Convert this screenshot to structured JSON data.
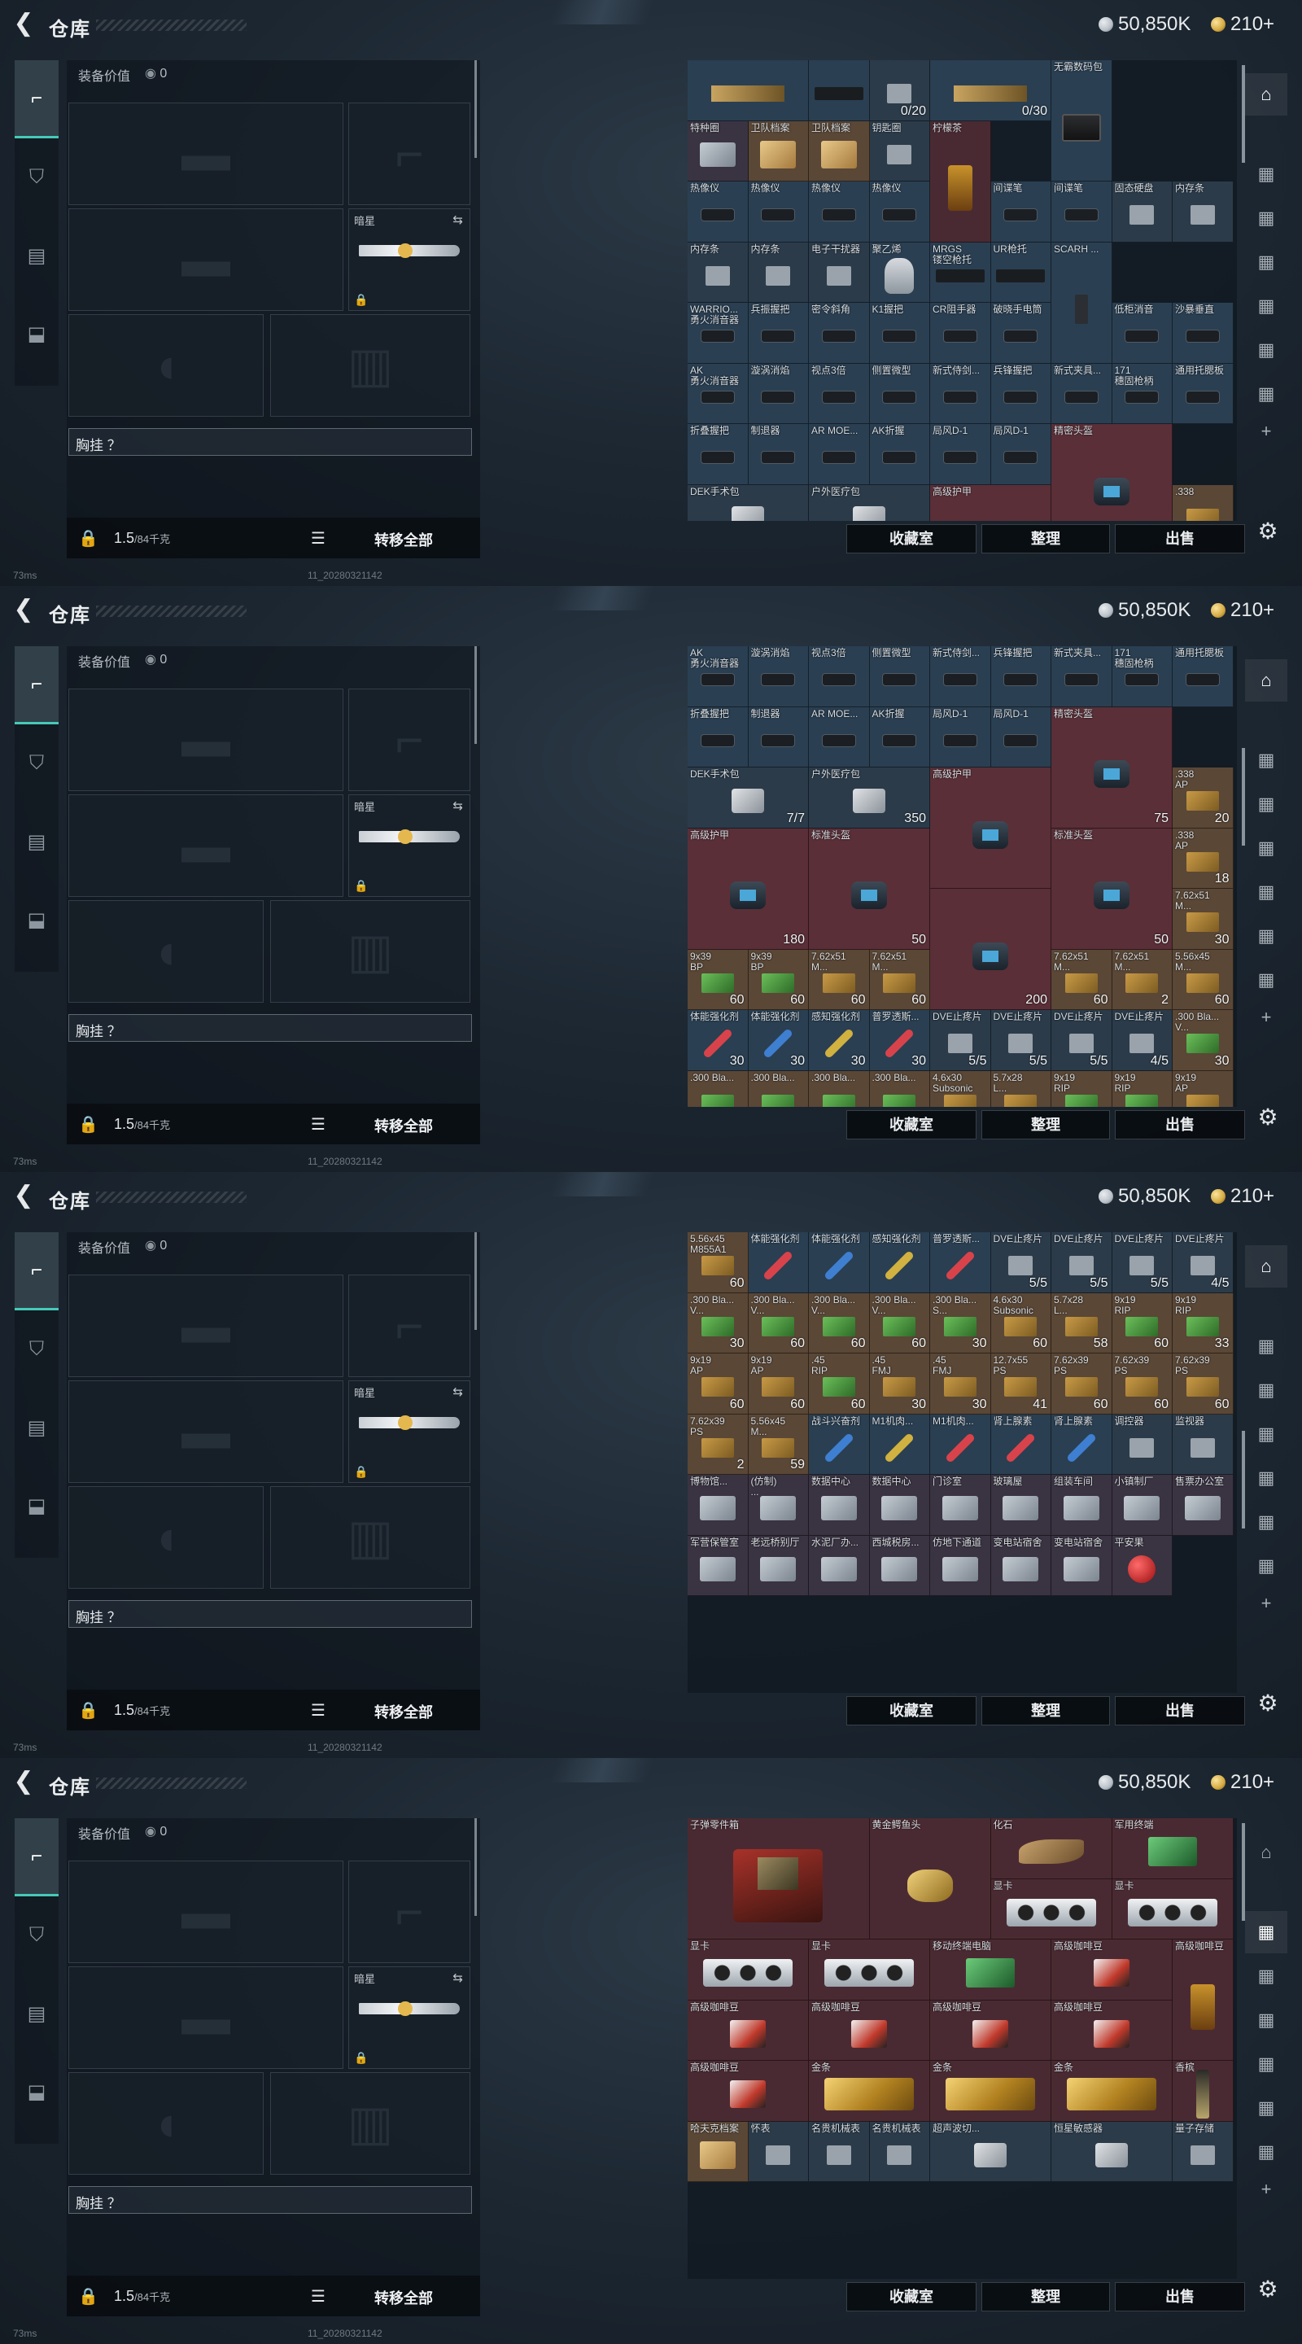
{
  "common": {
    "title": "仓库",
    "currency1": "50,850K",
    "currency2": "210+",
    "currency1_color": "#b9c0c7",
    "currency2_color": "#d4a942",
    "equip_label": "装备价值",
    "equip_value": "0",
    "melee_name": "暗星",
    "vest_label": "胸挂 ？",
    "weight": "1.5",
    "weight_cap": "/84千克",
    "transfer_all": "转移全部",
    "buttons": [
      "收藏室",
      "整理",
      "出售"
    ],
    "ping": "73ms",
    "version": "11_20280321142",
    "accent": "#46c9b8"
  },
  "panels": [
    {
      "scroll_pos": 0.0,
      "rightnav_active": 0
    },
    {
      "scroll_pos": 0.33,
      "rightnav_active": 0
    },
    {
      "scroll_pos": 0.66,
      "rightnav_active": 0
    },
    {
      "scroll_pos": 0.0,
      "rightnav_active": 1
    }
  ],
  "grids": [
    {
      "rows": [
        [
          [
            "",
            "rifle",
            ""
          ],
          [
            "",
            "gun",
            ""
          ],
          [
            "",
            "chip",
            "0/20"
          ],
          [
            "",
            "rifle",
            "0/30"
          ],
          [
            "无霸数码包",
            "radio",
            ""
          ]
        ],
        [
          [
            "特种圈",
            "card",
            ""
          ],
          [
            "卫队档案",
            "doc",
            ""
          ],
          [
            "卫队档案",
            "doc",
            ""
          ],
          [
            "钥匙圈",
            "chip",
            ""
          ],
          [
            "柠檬茶",
            "bag",
            ""
          ]
        ],
        [
          [
            "热像仪",
            "part",
            ""
          ],
          [
            "热像仪",
            "part",
            ""
          ],
          [
            "热像仪",
            "part",
            ""
          ],
          [
            "热像仪",
            "part",
            ""
          ],
          [
            "间谍笔",
            "part",
            ""
          ],
          [
            "间谍笔",
            "part",
            ""
          ],
          [
            "固态硬盘",
            "chip",
            ""
          ],
          [
            "内存条",
            "chip",
            ""
          ]
        ],
        [
          [
            "内存条",
            "chip",
            ""
          ],
          [
            "内存条",
            "chip",
            ""
          ],
          [
            "电子干扰器",
            "chip",
            ""
          ],
          [
            "聚乙烯",
            "kettle",
            ""
          ],
          [
            "MRGS\n镂空枪托",
            "gun",
            ""
          ],
          [
            "UR枪托",
            "gun",
            ""
          ],
          [
            "SCARH ...",
            "mag",
            ""
          ]
        ],
        [
          [
            "WARRIO...\n勇火消音器",
            "part",
            ""
          ],
          [
            "兵振握把",
            "part",
            ""
          ],
          [
            "密令斜角",
            "part",
            ""
          ],
          [
            "K1握把",
            "part",
            ""
          ],
          [
            "CR阻手器",
            "part",
            ""
          ],
          [
            "破晓手电筒",
            "part",
            ""
          ],
          [
            "低柜消音",
            "part",
            ""
          ],
          [
            "沙暴垂直",
            "part",
            ""
          ]
        ],
        [
          [
            "AK\n勇火消音器",
            "part",
            ""
          ],
          [
            "漩涡消焰",
            "part",
            ""
          ],
          [
            "视点3倍",
            "part",
            ""
          ],
          [
            "侧置微型",
            "part",
            ""
          ],
          [
            "新式侍剑...",
            "part",
            ""
          ],
          [
            "兵锋握把",
            "part",
            ""
          ],
          [
            "新式夹具...",
            "part",
            ""
          ],
          [
            "171\n穗固枪柄",
            "part",
            ""
          ],
          [
            "通用托腮板",
            "part",
            ""
          ]
        ],
        [
          [
            "折叠握把",
            "part",
            ""
          ],
          [
            "制退器",
            "part",
            ""
          ],
          [
            "AR MOE...",
            "part",
            ""
          ],
          [
            "AK折握",
            "part",
            ""
          ],
          [
            "局风D-1",
            "part",
            ""
          ],
          [
            "局风D-1",
            "part",
            ""
          ],
          [
            "精密头盔",
            "gear",
            "75"
          ]
        ],
        [
          [
            "DEK手术包",
            "tool",
            ""
          ],
          [
            "户外医疗包",
            "tool",
            ""
          ],
          [
            "高级护甲",
            "gear",
            ""
          ],
          [
            ".338",
            "ammo",
            ""
          ]
        ]
      ]
    },
    {
      "rows": [
        [
          [
            "AK\n勇火消音器",
            "part",
            ""
          ],
          [
            "漩涡消焰",
            "part",
            ""
          ],
          [
            "视点3倍",
            "part",
            ""
          ],
          [
            "侧置微型",
            "part",
            ""
          ],
          [
            "新式侍剑...",
            "part",
            ""
          ],
          [
            "兵锋握把",
            "part",
            ""
          ],
          [
            "新式夹具...",
            "part",
            ""
          ],
          [
            "171\n穗固枪柄",
            "part",
            ""
          ],
          [
            "通用托腮板",
            "part",
            ""
          ]
        ],
        [
          [
            "折叠握把",
            "part",
            ""
          ],
          [
            "制退器",
            "part",
            ""
          ],
          [
            "AR MOE...",
            "part",
            ""
          ],
          [
            "AK折握",
            "part",
            ""
          ],
          [
            "局风D-1",
            "part",
            ""
          ],
          [
            "局风D-1",
            "part",
            ""
          ],
          [
            "精密头盔",
            "gear",
            "75"
          ]
        ],
        [
          [
            "DEK手术包",
            "tool",
            "7/7"
          ],
          [
            "户外医疗包",
            "tool",
            "350"
          ],
          [
            "高级护甲",
            "gear",
            ""
          ],
          [
            ".338\nAP",
            "ammo",
            "20"
          ]
        ],
        [
          [
            "高级护甲",
            "gear",
            "180"
          ],
          [
            "标准头盔",
            "gear",
            "50"
          ],
          [
            "标准头盔",
            "gear",
            "50"
          ],
          [
            "",
            "gear",
            "200"
          ],
          [
            ".338\nAP",
            "ammo",
            "18"
          ]
        ],
        [
          [
            "7.62x51\nM...",
            "ammo",
            "30"
          ],
          [
            "9x39\nBP",
            "ammog",
            "60"
          ],
          [
            "9x39\nBP",
            "ammog",
            "60"
          ],
          [
            "7.62x51\nM...",
            "ammo",
            "60"
          ],
          [
            "7.62x51\nM...",
            "ammo",
            "60"
          ],
          [
            "7.62x51\nM...",
            "ammo",
            "60"
          ],
          [
            "7.62x51\nM...",
            "ammo",
            "2"
          ]
        ],
        [
          [
            "5.56x45\nM...",
            "ammo",
            "60"
          ],
          [
            "体能强化剂",
            "inj",
            "30"
          ],
          [
            "体能强化剂",
            "inj",
            "30"
          ],
          [
            "感知强化剂",
            "inj",
            "30"
          ],
          [
            "普罗透斯...",
            "inj",
            "30"
          ],
          [
            "DVE止疼片",
            "chip",
            "5/5"
          ],
          [
            "DVE止疼片",
            "chip",
            "5/5"
          ],
          [
            "DVE止疼片",
            "chip",
            "5/5"
          ],
          [
            "DVE止疼片",
            "chip",
            "4/5"
          ]
        ],
        [
          [
            ".300 Bla...\nV...",
            "ammog",
            "30"
          ],
          [
            ".300 Bla...",
            "ammog",
            "60"
          ],
          [
            ".300 Bla...",
            "ammog",
            "60"
          ],
          [
            ".300 Bla...",
            "ammog",
            "60"
          ],
          [
            ".300 Bla...",
            "ammog",
            "30"
          ],
          [
            "4.6x30\nSubsonic",
            "ammo",
            "60"
          ],
          [
            "5.7x28\nL...",
            "ammo",
            "58"
          ],
          [
            "9x19\nRIP",
            "ammog",
            "60"
          ],
          [
            "9x19\nRIP",
            "ammog",
            "33"
          ]
        ],
        [
          [
            "9x19\nAP",
            "ammo",
            ""
          ],
          [
            "9x19\nAP",
            "ammo",
            ""
          ],
          [
            ".45",
            "ammo",
            ""
          ],
          [
            ".45",
            "ammo",
            ""
          ],
          [
            "12.7x55\nPS",
            "ammo",
            ""
          ],
          [
            "7.62x39\nPS",
            "ammo",
            ""
          ],
          [
            "7.62x39\nPS",
            "ammo",
            ""
          ],
          [
            "7.62x39\nPS",
            "ammo",
            ""
          ]
        ]
      ]
    },
    {
      "rows": [
        [
          [
            "5.56x45\nM855A1",
            "ammo",
            "60"
          ],
          [
            "体能强化剂",
            "inj",
            ""
          ],
          [
            "体能强化剂",
            "inj",
            ""
          ],
          [
            "感知强化剂",
            "inj",
            ""
          ],
          [
            "普罗透斯...",
            "inj",
            ""
          ],
          [
            "DVE止疼片",
            "chip",
            "5/5"
          ],
          [
            "DVE止疼片",
            "chip",
            "5/5"
          ],
          [
            "DVE止疼片",
            "chip",
            "5/5"
          ],
          [
            "DVE止疼片",
            "chip",
            "4/5"
          ]
        ],
        [
          [
            ".300 Bla...\nV...",
            "ammog",
            "30"
          ],
          [
            ".300 Bla...\nV...",
            "ammog",
            "60"
          ],
          [
            ".300 Bla...\nV...",
            "ammog",
            "60"
          ],
          [
            ".300 Bla...\nV...",
            "ammog",
            "60"
          ],
          [
            ".300 Bla...\nS...",
            "ammog",
            "30"
          ],
          [
            "4.6x30\nSubsonic",
            "ammo",
            "60"
          ],
          [
            "5.7x28\nL...",
            "ammo",
            "58"
          ],
          [
            "9x19\nRIP",
            "ammog",
            "60"
          ],
          [
            "9x19\nRIP",
            "ammog",
            "33"
          ]
        ],
        [
          [
            "9x19\nAP",
            "ammo",
            "60"
          ],
          [
            "9x19\nAP",
            "ammo",
            "60"
          ],
          [
            ".45\nRIP",
            "ammog",
            "60"
          ],
          [
            ".45\nFMJ",
            "ammo",
            "30"
          ],
          [
            ".45\nFMJ",
            "ammo",
            "30"
          ],
          [
            "12.7x55\nPS",
            "ammo",
            "41"
          ],
          [
            "7.62x39\nPS",
            "ammo",
            "60"
          ],
          [
            "7.62x39\nPS",
            "ammo",
            "60"
          ],
          [
            "7.62x39\nPS",
            "ammo",
            "60"
          ]
        ],
        [
          [
            "7.62x39\nPS",
            "ammo",
            "2"
          ],
          [
            "5.56x45\nM...",
            "ammo",
            "59"
          ],
          [
            "战斗兴奋剂",
            "inj",
            ""
          ],
          [
            "M1机肉...",
            "inj",
            ""
          ],
          [
            "M1机肉...",
            "inj",
            ""
          ],
          [
            "肾上腺素",
            "inj",
            ""
          ],
          [
            "肾上腺素",
            "inj",
            ""
          ],
          [
            "调控器",
            "chip",
            ""
          ],
          [
            "监视器",
            "chip",
            ""
          ]
        ],
        [
          [
            "博物馆...",
            "card",
            ""
          ],
          [
            "(仿制)\n...",
            "card",
            ""
          ],
          [
            "数据中心",
            "card",
            ""
          ],
          [
            "数据中心",
            "card",
            ""
          ],
          [
            "门诊室",
            "card",
            ""
          ],
          [
            "玻璃屋",
            "card",
            ""
          ],
          [
            "组装车间",
            "card",
            ""
          ],
          [
            "小镇制厂",
            "card",
            ""
          ],
          [
            "售票办公室",
            "card",
            ""
          ]
        ],
        [
          [
            "军营保管室",
            "card",
            ""
          ],
          [
            "老远桥别厅",
            "card",
            ""
          ],
          [
            "水泥厂办...",
            "card",
            ""
          ],
          [
            "西城税房...",
            "card",
            ""
          ],
          [
            "仿地下通道",
            "card",
            ""
          ],
          [
            "变电站宿舍",
            "card",
            ""
          ],
          [
            "变电站宿舍",
            "card",
            ""
          ],
          [
            "平安果",
            "apple",
            ""
          ]
        ]
      ]
    },
    {
      "rows": [
        [
          [
            "子弹零件箱",
            "bigcase",
            ""
          ],
          [
            "黄金鳄鱼头",
            "stat",
            ""
          ],
          [
            "化石",
            "fossil",
            ""
          ],
          [
            "军用终端",
            "greenpcb",
            ""
          ]
        ],
        [
          [
            "显卡",
            "gpu",
            ""
          ],
          [
            "显卡",
            "gpu",
            ""
          ]
        ],
        [
          [
            "显卡",
            "gpu",
            ""
          ],
          [
            "显卡",
            "gpu",
            ""
          ],
          [
            "移动终端电脑",
            "greenpcb",
            ""
          ],
          [
            "高级咖啡豆",
            "coffee",
            ""
          ],
          [
            "高级咖啡豆",
            "bag",
            ""
          ]
        ],
        [
          [
            "高级咖啡豆",
            "coffee",
            ""
          ],
          [
            "高级咖啡豆",
            "coffee",
            ""
          ],
          [
            "高级咖啡豆",
            "coffee",
            ""
          ],
          [
            "高级咖啡豆",
            "coffee",
            ""
          ]
        ],
        [
          [
            "高级咖啡豆",
            "coffee",
            ""
          ],
          [
            "金条",
            "gold",
            ""
          ],
          [
            "金条",
            "gold",
            ""
          ],
          [
            "金条",
            "gold",
            ""
          ],
          [
            "香槟",
            "bottle",
            ""
          ]
        ],
        [
          [
            "哈夫克档案",
            "doc",
            ""
          ],
          [
            "怀表",
            "chip",
            ""
          ],
          [
            "名贵机械表",
            "chip",
            ""
          ],
          [
            "名贵机械表",
            "chip",
            ""
          ],
          [
            "超声波切...",
            "tool",
            ""
          ],
          [
            "恒星敏感器",
            "tool",
            ""
          ],
          [
            "量子存储",
            "chip",
            ""
          ]
        ]
      ]
    }
  ]
}
